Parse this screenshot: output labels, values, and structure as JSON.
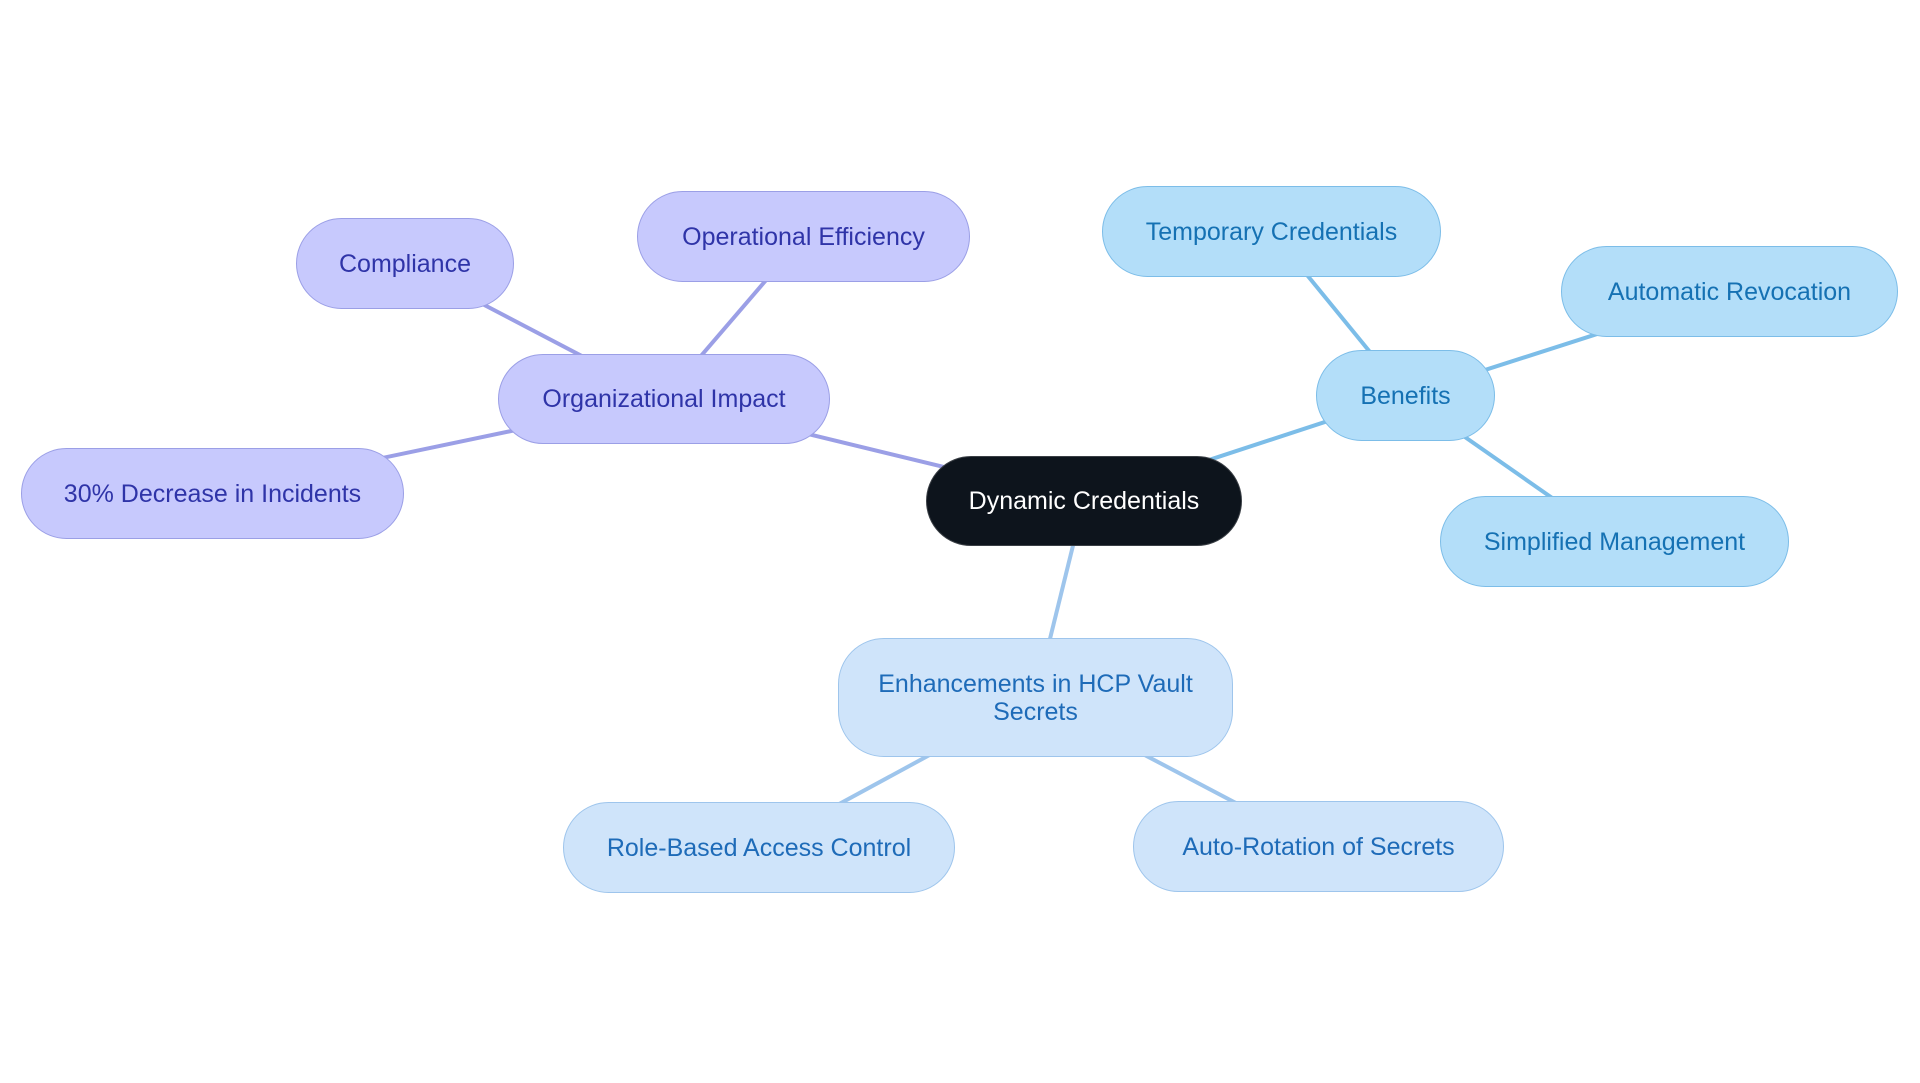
{
  "diagram": {
    "type": "mind-map",
    "colors": {
      "root_fill": "#0d141c",
      "root_text": "#ffffff",
      "organizational_fill": "#c7c9fd",
      "organizational_stroke": "#9b9fe6",
      "organizational_text": "#2f34a8",
      "benefits_fill": "#b3def9",
      "benefits_stroke": "#7cbde8",
      "benefits_text": "#1571b3",
      "enhancements_fill": "#cfe4fa",
      "enhancements_stroke": "#9ec5ec",
      "enhancements_text": "#1e6bb8"
    },
    "root": {
      "label": "Dynamic Credentials"
    },
    "branches": [
      {
        "id": "organizational-impact",
        "label": "Organizational Impact",
        "children": [
          {
            "label": "Compliance"
          },
          {
            "label": "Operational Efficiency"
          },
          {
            "label": "30% Decrease in Incidents"
          }
        ]
      },
      {
        "id": "benefits",
        "label": "Benefits",
        "children": [
          {
            "label": "Temporary Credentials"
          },
          {
            "label": "Automatic Revocation"
          },
          {
            "label": "Simplified Management"
          }
        ]
      },
      {
        "id": "enhancements",
        "label": "Enhancements in HCP Vault Secrets",
        "children": [
          {
            "label": "Role-Based Access Control"
          },
          {
            "label": "Auto-Rotation of Secrets"
          }
        ]
      }
    ]
  }
}
